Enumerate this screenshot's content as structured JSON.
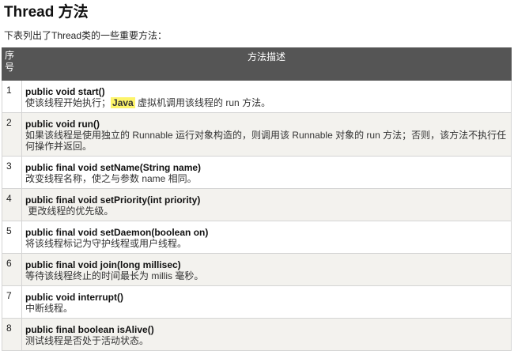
{
  "heading": "Thread 方法",
  "intro": "下表列出了Thread类的一些重要方法：",
  "table": {
    "headers": {
      "index": "序号",
      "description": "方法描述"
    },
    "rows": [
      {
        "num": "1",
        "signature": "public void start()",
        "desc_pre": "使该线程开始执行；",
        "desc_highlight": "Java",
        "desc_post": " 虚拟机调用该线程的 run 方法。"
      },
      {
        "num": "2",
        "signature": "public void run()",
        "desc": "如果该线程是使用独立的 Runnable 运行对象构造的，则调用该 Runnable 对象的 run 方法；否则，该方法不执行任何操作并返回。"
      },
      {
        "num": "3",
        "signature": "public final void setName(String name)",
        "desc": "改变线程名称，使之与参数 name 相同。"
      },
      {
        "num": "4",
        "signature": "public final void setPriority(int priority)",
        "desc": " 更改线程的优先级。"
      },
      {
        "num": "5",
        "signature": "public final void setDaemon(boolean on)",
        "desc": "将该线程标记为守护线程或用户线程。"
      },
      {
        "num": "6",
        "signature": "public final void join(long millisec)",
        "desc": "等待该线程终止的时间最长为 millis 毫秒。"
      },
      {
        "num": "7",
        "signature": "public void interrupt()",
        "desc": "中断线程。"
      },
      {
        "num": "8",
        "signature": "public final boolean isAlive()",
        "desc": "测试线程是否处于活动状态。"
      }
    ]
  },
  "colors": {
    "header_bg": "#555555",
    "stripe": "#f3f2ee",
    "highlight": "#fdf46a"
  }
}
